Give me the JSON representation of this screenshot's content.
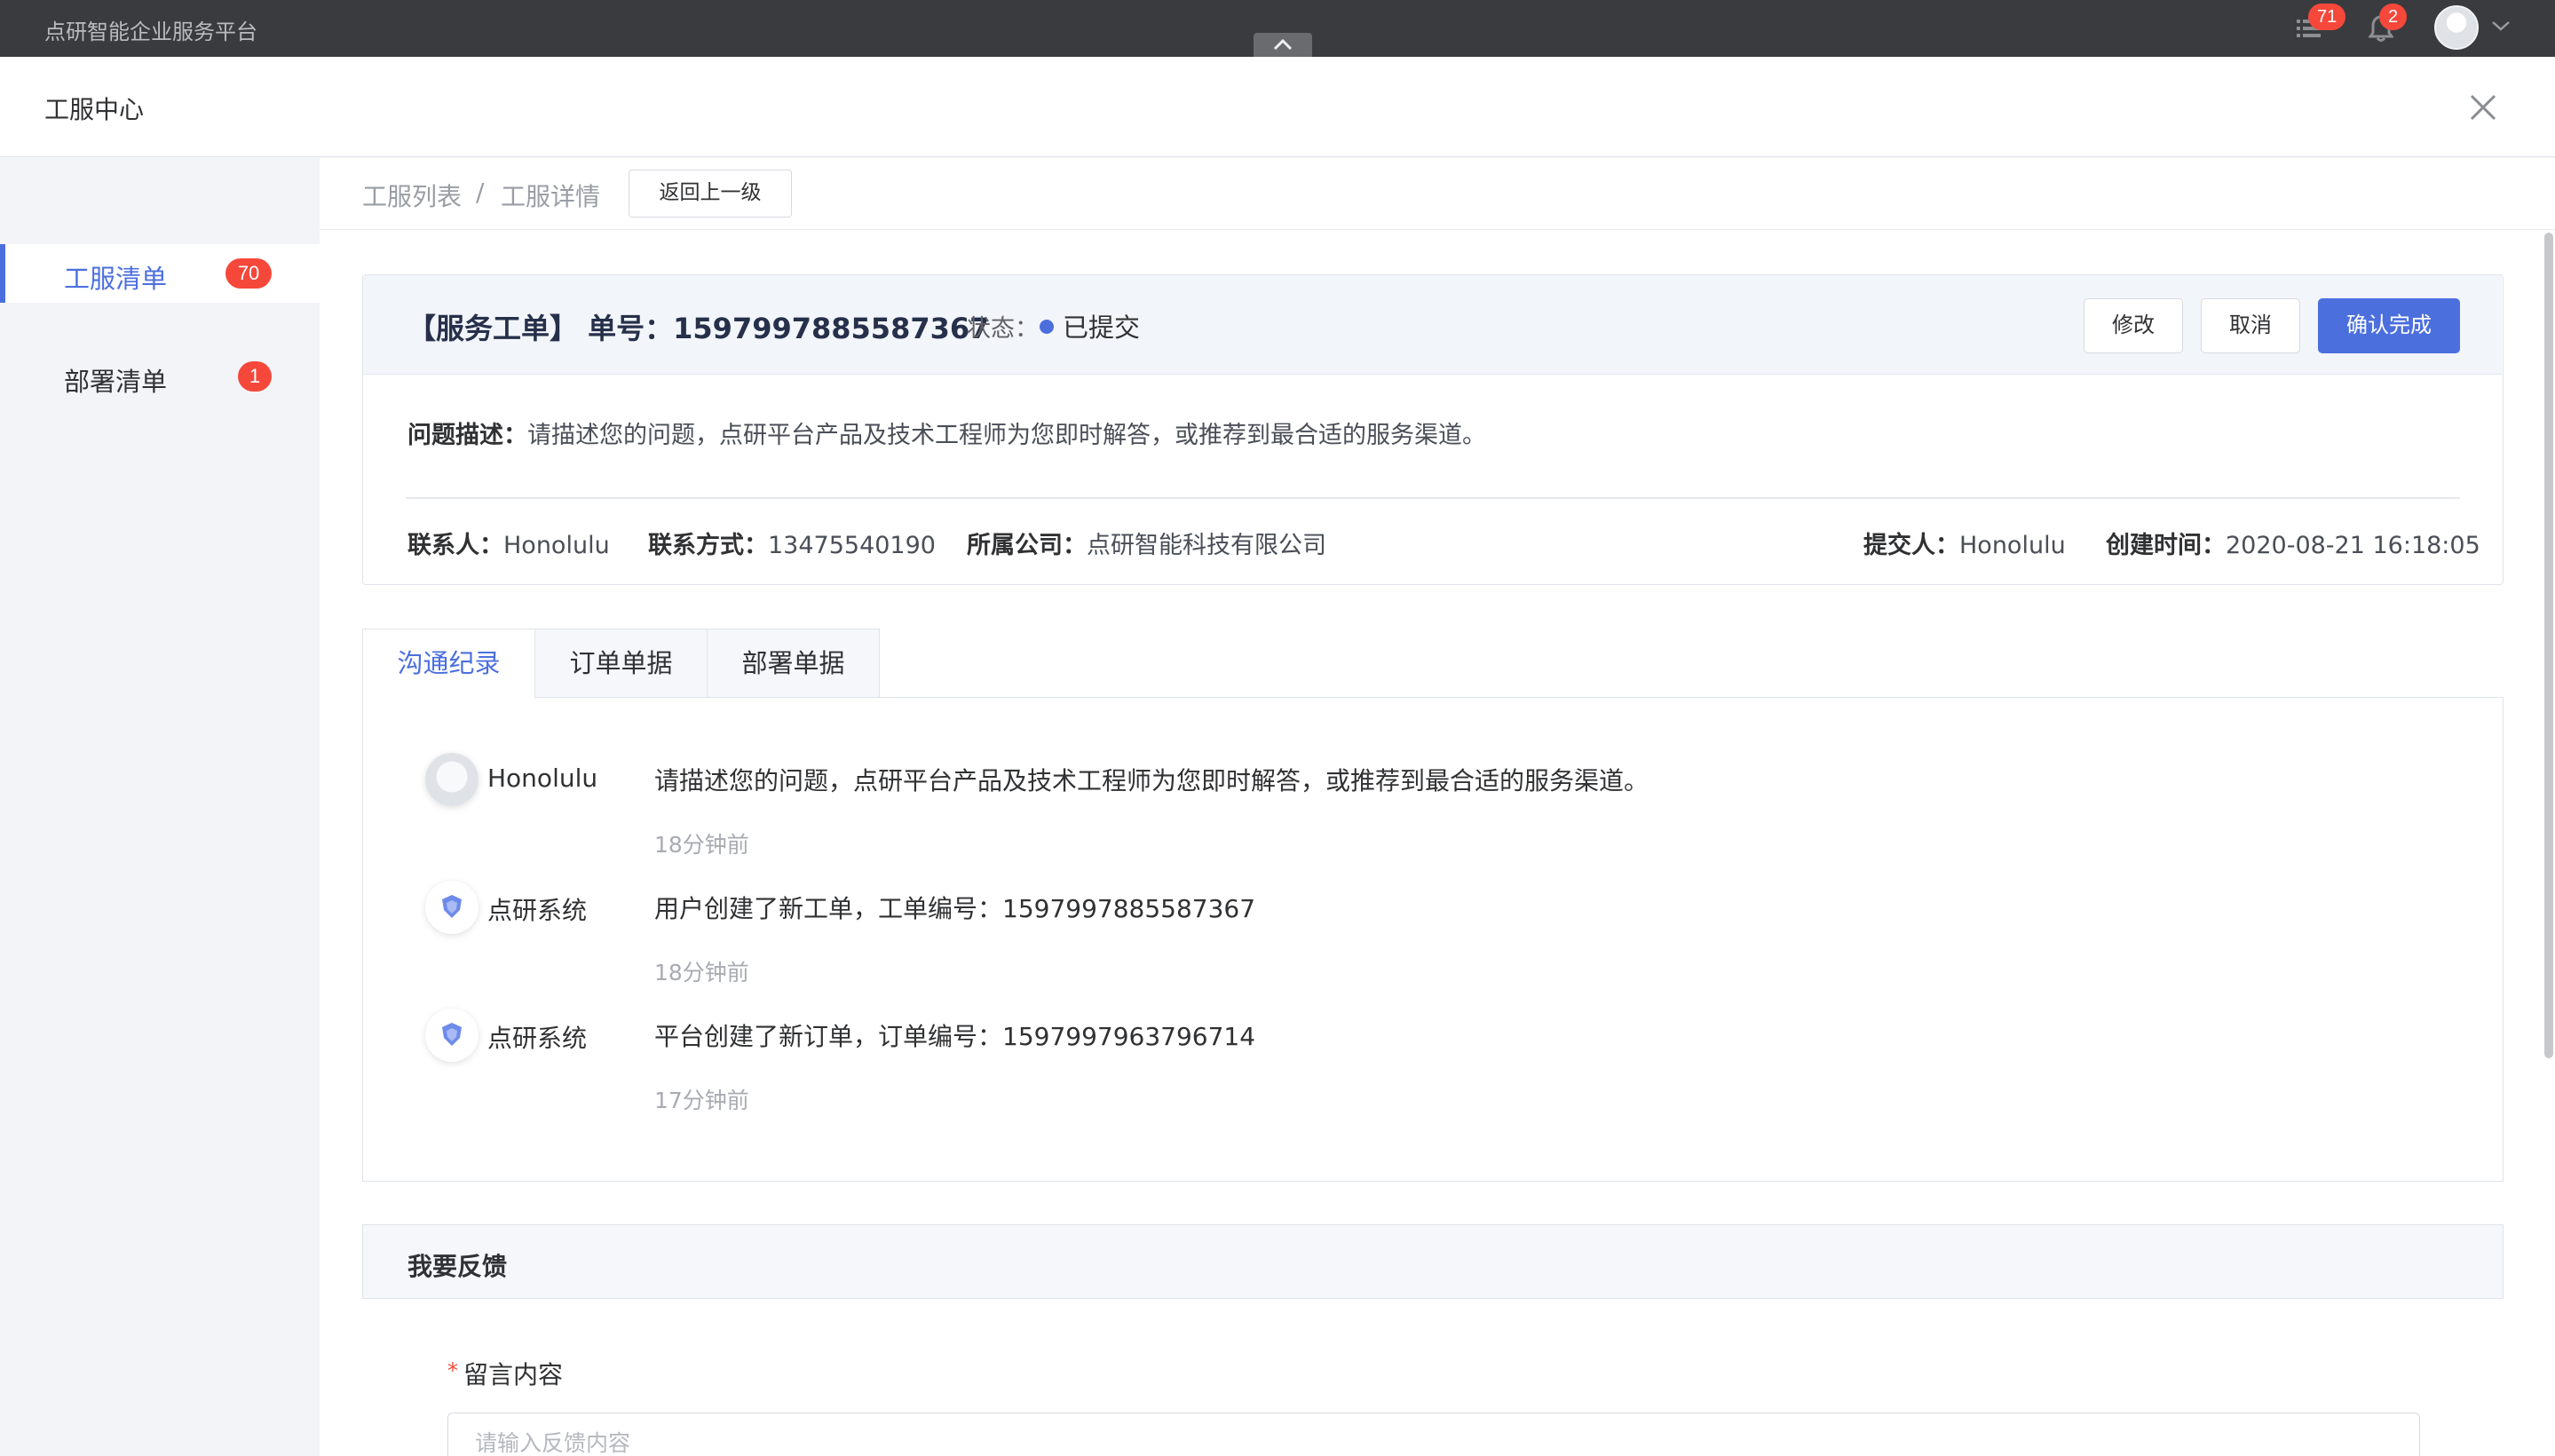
{
  "app": {
    "brand": "点研智能企业服务平台"
  },
  "topbar": {
    "list_badge": "71",
    "bell_badge": "2",
    "icons": {
      "list": "list-icon",
      "bell": "bell-icon",
      "avatar": "avatar",
      "caret": "chevron-down-icon",
      "collapse": "chevron-up-icon"
    }
  },
  "panel": {
    "title": "工服中心",
    "close_icon": "close-icon"
  },
  "sidebar": {
    "items": [
      {
        "label": "工服清单",
        "badge": "70",
        "active": true
      },
      {
        "label": "部署清单",
        "badge": "1",
        "active": false
      }
    ]
  },
  "breadcrumb": {
    "items": [
      "工服列表",
      "工服详情"
    ],
    "separator": "/",
    "back_label": "返回上一级"
  },
  "order": {
    "title": "【服务工单】 单号：1597997885587367",
    "status_label": "状态：",
    "status_value": "已提交",
    "status_color": "#4c6fde",
    "actions": {
      "edit": "修改",
      "cancel": "取消",
      "confirm": "确认完成"
    },
    "description_label": "问题描述：",
    "description": "请描述您的问题，点研平台产品及技术工程师为您即时解答，或推荐到最合适的服务渠道。",
    "contact_label": "联系人：",
    "contact": "Honolulu",
    "phone_label": "联系方式：",
    "phone": "13475540190",
    "company_label": "所属公司：",
    "company": "点研智能科技有限公司",
    "submitter_label": "提交人：",
    "submitter": "Honolulu",
    "created_label": "创建时间：",
    "created": "2020-08-21 16:18:05"
  },
  "tabs": [
    {
      "label": "沟通纪录",
      "active": true
    },
    {
      "label": "订单单据",
      "active": false
    },
    {
      "label": "部署单据",
      "active": false
    }
  ],
  "messages": [
    {
      "name": "Honolulu",
      "avatar": "user-avatar",
      "text": "请描述您的问题，点研平台产品及技术工程师为您即时解答，或推荐到最合适的服务渠道。",
      "time": "18分钟前"
    },
    {
      "name": "点研系统",
      "avatar": "shield-icon",
      "text": "用户创建了新工单，工单编号：1597997885587367",
      "time": "18分钟前"
    },
    {
      "name": "点研系统",
      "avatar": "shield-icon",
      "text": "平台创建了新订单，订单编号：1597997963796714",
      "time": "17分钟前"
    }
  ],
  "feedback": {
    "title": "我要反馈",
    "required_mark": "*",
    "field_label": "留言内容",
    "placeholder": "请输入反馈内容",
    "value": ""
  },
  "colors": {
    "accent": "#4c6fde",
    "badge": "#f5483b",
    "topbar": "#3a3b3e"
  }
}
